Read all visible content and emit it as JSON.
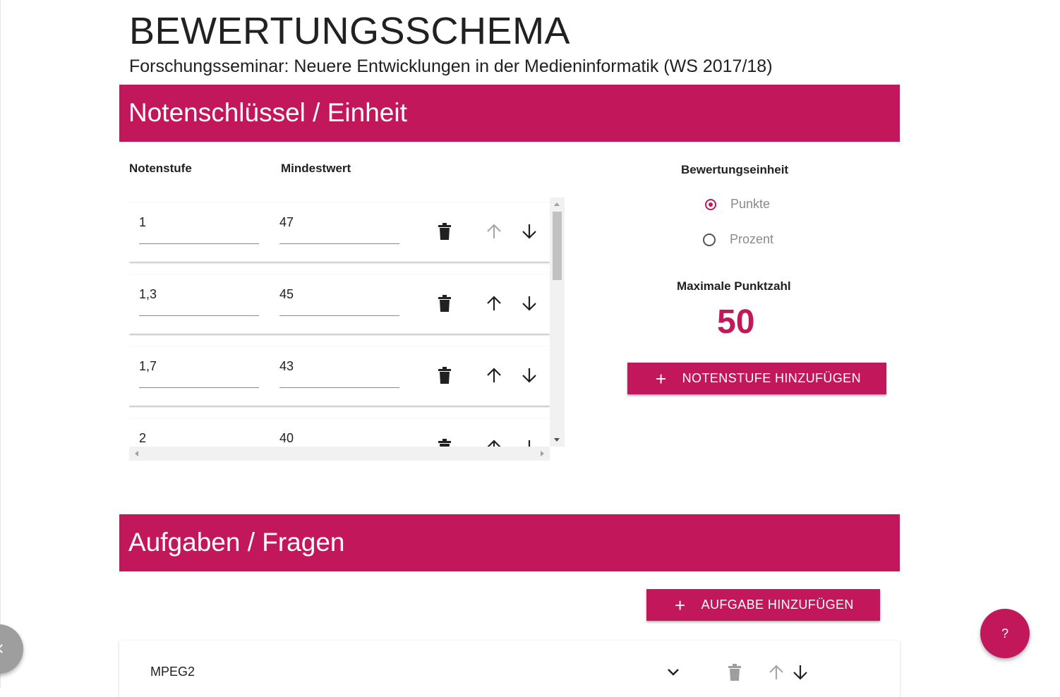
{
  "header": {
    "title": "BEWERTUNGSSCHEMA",
    "subtitle": "Forschungsseminar: Neuere Entwicklungen in der Medieninformatik (WS 2017/18)"
  },
  "grading_section": {
    "heading": "Notenschlüssel / Einheit",
    "column_grade": "Notenstufe",
    "column_min": "Mindestwert",
    "rows": [
      {
        "grade": "1",
        "min": "47",
        "up_enabled": false
      },
      {
        "grade": "1,3",
        "min": "45",
        "up_enabled": true
      },
      {
        "grade": "1,7",
        "min": "43",
        "up_enabled": true
      },
      {
        "grade": "2",
        "min": "40",
        "up_enabled": true
      }
    ]
  },
  "unit_panel": {
    "label": "Bewertungseinheit",
    "options": [
      "Punkte",
      "Prozent"
    ],
    "selected": "Punkte",
    "max_label": "Maximale Punktzahl",
    "max_value": "50",
    "add_grade_button": "NOTENSTUFE HINZUFÜGEN"
  },
  "tasks_section": {
    "heading": "Aufgaben / Fragen",
    "add_task_button": "AUFGABE HINZUFÜGEN",
    "tasks": [
      {
        "name": "MPEG2"
      }
    ]
  },
  "help_button": "?",
  "colors": {
    "accent": "#c2185b",
    "disabled": "#9e9e9e"
  },
  "icons": [
    "trash-icon",
    "arrow-up-icon",
    "arrow-down-icon",
    "chevron-down-icon",
    "plus-icon",
    "chevron-left-icon"
  ]
}
